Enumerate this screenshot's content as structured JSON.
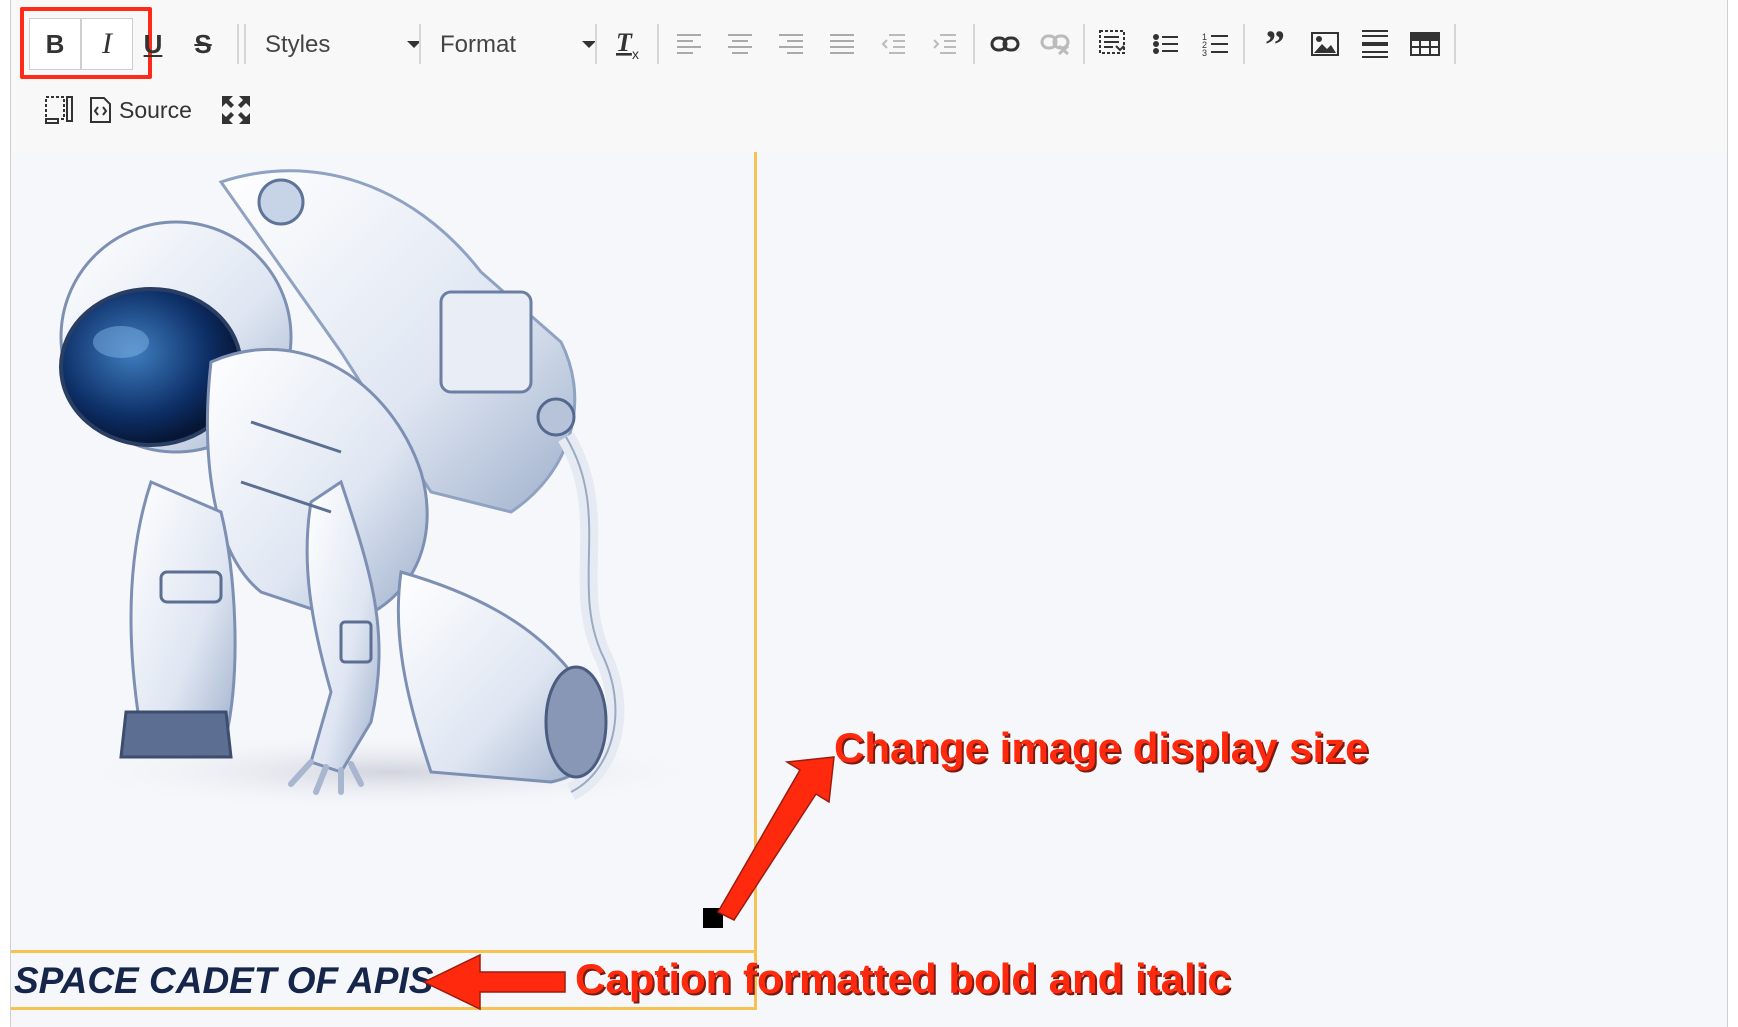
{
  "toolbar": {
    "bold_label": "B",
    "italic_label": "I",
    "underline_label": "U",
    "strike_label": "S",
    "styles_label": "Styles",
    "format_label": "Format",
    "source_label": "Source",
    "icons": [
      "bold-icon",
      "italic-icon",
      "underline-icon",
      "strikethrough-icon",
      "remove-format-icon",
      "align-left-icon",
      "align-center-icon",
      "align-right-icon",
      "justify-icon",
      "outdent-icon",
      "indent-icon",
      "link-icon",
      "unlink-icon",
      "anchor-icon",
      "bulleted-list-icon",
      "numbered-list-icon",
      "blockquote-icon",
      "image-icon",
      "horizontal-rule-icon",
      "table-icon",
      "show-blocks-icon",
      "source-icon",
      "maximize-icon"
    ]
  },
  "content": {
    "image_subject": "astronaut-image",
    "caption": "SPACE CADET OF APIS"
  },
  "annotations": {
    "resize_note": "Change image display size",
    "caption_note": "Caption formatted bold and italic"
  },
  "colors": {
    "highlight": "#ff2a17",
    "selection_border": "#f6c352",
    "caption_text": "#16264a",
    "annotation": "#ff2a0d"
  }
}
